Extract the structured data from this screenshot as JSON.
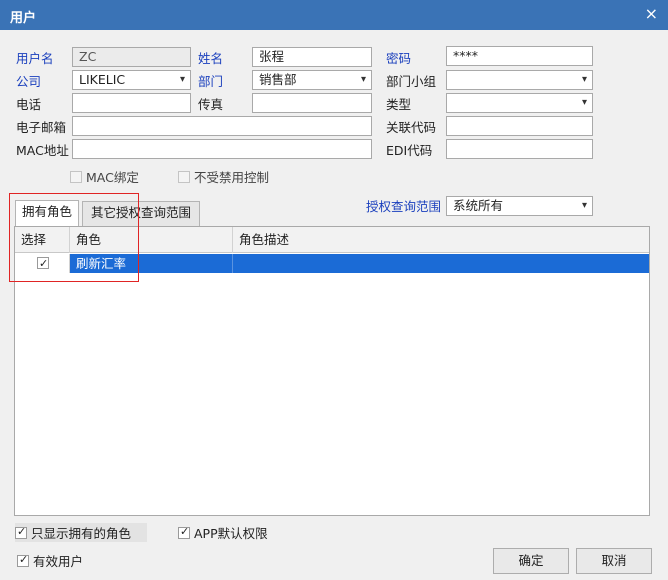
{
  "window": {
    "title": "用户",
    "close_glyph": "×"
  },
  "form": {
    "username_label": "用户名",
    "username_value": "ZC",
    "name_label": "姓名",
    "name_value": "张程",
    "password_label": "密码",
    "password_value": "****",
    "company_label": "公司",
    "company_value": "LIKELIC",
    "dept_label": "部门",
    "dept_value": "销售部",
    "dept_group_label": "部门小组",
    "dept_group_value": "",
    "phone_label": "电话",
    "phone_value": "",
    "fax_label": "传真",
    "fax_value": "",
    "type_label": "类型",
    "type_value": "",
    "email_label": "电子邮箱",
    "email_value": "",
    "linked_code_label": "关联代码",
    "linked_code_value": "",
    "mac_label": "MAC地址",
    "mac_value": "",
    "edi_label": "EDI代码",
    "edi_value": "",
    "mac_bind_label": "MAC绑定",
    "mac_bind_checked": false,
    "no_disable_ctrl_label": "不受禁用控制",
    "no_disable_ctrl_checked": false
  },
  "tabs": {
    "roles_label": "拥有角色",
    "other_scope_label": "其它授权查询范围",
    "active": "roles"
  },
  "auth_scope": {
    "label": "授权查询范围",
    "value": "系统所有"
  },
  "grid": {
    "headers": {
      "select": "选择",
      "role": "角色",
      "desc": "角色描述"
    },
    "rows": [
      {
        "selected": true,
        "role": "刷新汇率",
        "desc": ""
      }
    ]
  },
  "options": {
    "only_owned_label": "只显示拥有的角色",
    "only_owned_checked": true,
    "app_default_label": "APP默认权限",
    "app_default_checked": true,
    "active_user_label": "有效用户",
    "active_user_checked": true
  },
  "buttons": {
    "ok": "确定",
    "cancel": "取消"
  },
  "colors": {
    "titlebar": "#3a73b6",
    "selection": "#1b6bd6",
    "highlight_border": "#e02424",
    "label_blue": "#1a3fbd"
  }
}
